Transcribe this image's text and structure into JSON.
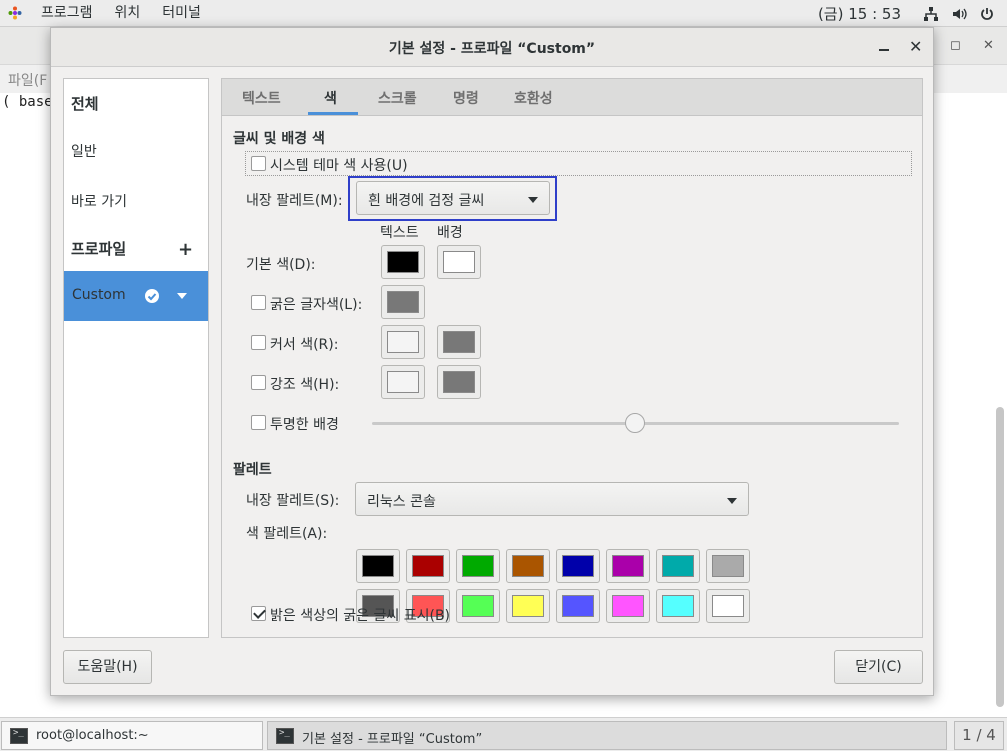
{
  "top_panel": {
    "menus": [
      "프로그램",
      "위치",
      "터미널"
    ],
    "clock": "(금) 15 : 53"
  },
  "bg_window": {
    "menu_fragment": "파일(F",
    "terminal_text": "( base)"
  },
  "dialog": {
    "title": "기본 설정 - 프로파일 “Custom”",
    "sidebar": {
      "all": "전체",
      "general": "일반",
      "shortcuts": "바로 가기",
      "profiles": "프로파일",
      "add_symbol": "+",
      "selected_profile": "Custom"
    },
    "tabs": [
      "텍스트",
      "색",
      "스크롤",
      "명령",
      "호환성"
    ],
    "active_tab": "색",
    "text_bg": {
      "section_title": "글씨 및 배경 색",
      "use_system_theme": "시스템 테마 색 사용(U)",
      "use_system_theme_checked": false,
      "builtin_scheme_label": "내장 팔레트(M):",
      "builtin_scheme_value": "흰 배경에 검정 글씨",
      "col_text": "텍스트",
      "col_bg": "배경",
      "default_color_label": "기본 색(D):",
      "default_text_color": "#000000",
      "default_bg_color": "#ffffff",
      "bold_color_label": "굵은 글자색(L):",
      "bold_color": "#787878",
      "cursor_color_label": "커서 색(R):",
      "cursor_text_color": "#f4f4f4",
      "cursor_bg_color": "#787878",
      "highlight_color_label": "강조 색(H):",
      "highlight_text_color": "#f4f4f4",
      "highlight_bg_color": "#787878",
      "transparent_label": "투명한 배경",
      "transparency_level": 0.5
    },
    "palette": {
      "section_title": "팔레트",
      "builtin_label": "내장 팔레트(S):",
      "builtin_value": "리눅스 콘솔",
      "color_palette_label": "색 팔레트(A):",
      "colors_row1": [
        "#000000",
        "#aa0000",
        "#00aa00",
        "#aa5500",
        "#0000aa",
        "#aa00aa",
        "#00aaaa",
        "#aaaaaa"
      ],
      "colors_row2": [
        "#555555",
        "#ff5555",
        "#55ff55",
        "#ffff55",
        "#5555ff",
        "#ff55ff",
        "#55ffff",
        "#ffffff"
      ],
      "bold_bright_label": "밝은 색상의 굵은 글씨 표시(B)",
      "bold_bright_checked": true
    },
    "help_button": "도움말(H)",
    "close_button": "닫기(C)"
  },
  "taskbar": {
    "tasks": [
      "root@localhost:~",
      "기본 설정 - 프로파일 “Custom”"
    ],
    "pager": "1 / 4"
  }
}
